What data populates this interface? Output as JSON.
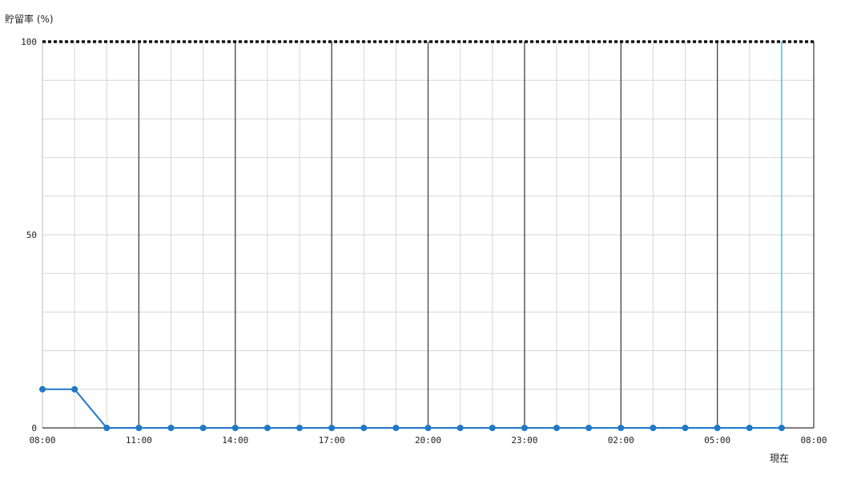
{
  "chart_data": {
    "type": "line",
    "title": "",
    "ylabel": "貯留率 (%)",
    "xlabel": "",
    "ylim": [
      0,
      100
    ],
    "y_ticks": [
      0,
      50,
      100
    ],
    "x_ticks": [
      "08:00",
      "11:00",
      "14:00",
      "17:00",
      "20:00",
      "23:00",
      "02:00",
      "05:00",
      "08:00"
    ],
    "x_tick_hours": [
      0,
      3,
      6,
      9,
      12,
      15,
      18,
      21,
      24
    ],
    "grid": true,
    "threshold_y": 100,
    "current_marker": {
      "label": "現在",
      "hour": 23,
      "color": "#56b8e6"
    },
    "series": [
      {
        "color": "#1f78c8",
        "x_hours": [
          0,
          1,
          2,
          3,
          4,
          5,
          6,
          7,
          8,
          9,
          10,
          11,
          12,
          13,
          14,
          15,
          16,
          17,
          18,
          19,
          20,
          21,
          22,
          23
        ],
        "values": [
          10,
          10,
          0,
          0,
          0,
          0,
          0,
          0,
          0,
          0,
          0,
          0,
          0,
          0,
          0,
          0,
          0,
          0,
          0,
          0,
          0,
          0,
          0,
          0
        ]
      }
    ]
  }
}
